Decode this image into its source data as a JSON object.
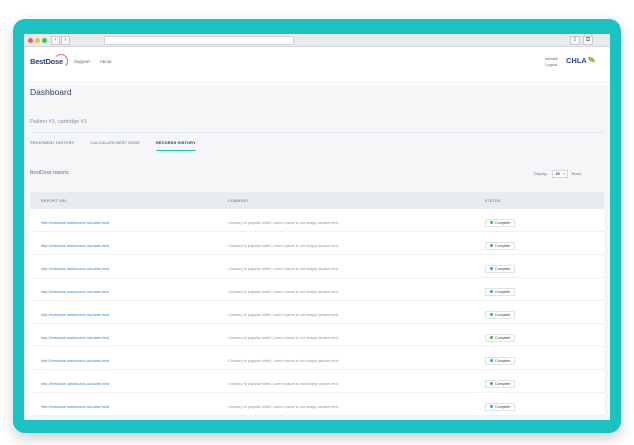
{
  "browser": {
    "back_arrow": "‹",
    "forward_arrow": "›",
    "share_glyph": "⇪",
    "tabs_glyph": "⧉"
  },
  "header": {
    "logo_text": "BestDose",
    "nav": [
      "Support",
      "About"
    ],
    "user_name": "admin2",
    "logout_label": "Logout",
    "org_logo_text": "CHLA"
  },
  "page": {
    "title": "Dashboard",
    "patient_label": "Patient #1, cartridge #1"
  },
  "tabs": [
    {
      "label": "TREATMENT HISTORY",
      "active": false
    },
    {
      "label": "CALCULATE BEST DOSE",
      "active": false
    },
    {
      "label": "RECORDS HISTORY",
      "active": true
    }
  ],
  "reports": {
    "title": "BestDose reports",
    "display_label": "Display:",
    "display_value": "20",
    "rows_label": "Rows"
  },
  "table": {
    "columns": [
      "REPORT URL",
      "COMMENT",
      "STATUS"
    ],
    "rows": [
      {
        "url": "http://bestdose.dashboard.calculate.best",
        "comment": "Contrary to popular belief, Lorem Ipsum is not simply random text.",
        "status": "Complete"
      },
      {
        "url": "http://bestdose.dashboard.calculate.best",
        "comment": "Contrary to popular belief, Lorem Ipsum is not simply random text.",
        "status": "Complete"
      },
      {
        "url": "http://bestdose.dashboard.calculate.best",
        "comment": "Contrary to popular belief, Lorem Ipsum is not simply random text.",
        "status": "Complete"
      },
      {
        "url": "http://bestdose.dashboard.calculate.best",
        "comment": "Contrary to popular belief, Lorem Ipsum is not simply random text.",
        "status": "Complete"
      },
      {
        "url": "http://bestdose.dashboard.calculate.best",
        "comment": "Contrary to popular belief, Lorem Ipsum is not simply random text.",
        "status": "Complete"
      },
      {
        "url": "http://bestdose.dashboard.calculate.best",
        "comment": "Contrary to popular belief, Lorem Ipsum is not simply random text.",
        "status": "Complete"
      },
      {
        "url": "http://bestdose.dashboard.calculate.best",
        "comment": "Contrary to popular belief, Lorem Ipsum is not simply random text.",
        "status": "Complete"
      },
      {
        "url": "http://bestdose.dashboard.calculate.best",
        "comment": "Contrary to popular belief, Lorem Ipsum is not simply random text.",
        "status": "Complete"
      },
      {
        "url": "http://bestdose.dashboard.calculate.best",
        "comment": "Contrary to popular belief, Lorem Ipsum is not simply random text.",
        "status": "Complete"
      }
    ]
  },
  "colors": {
    "accent": "#1bc2c2",
    "status_complete": "#3bb54a",
    "link": "#2e8bd8"
  }
}
